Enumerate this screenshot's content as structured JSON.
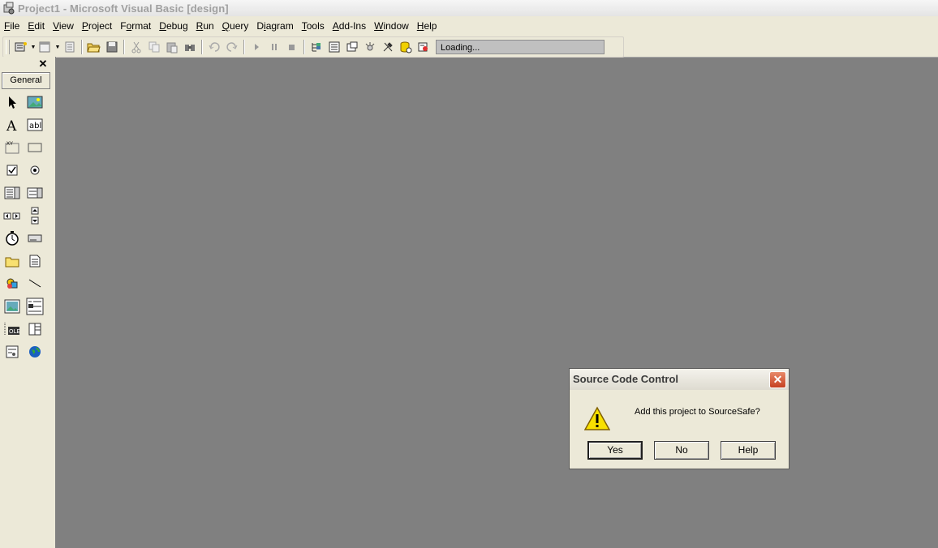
{
  "window": {
    "title": "Project1 - Microsoft Visual Basic [design]"
  },
  "menubar": {
    "items": [
      {
        "label": "File",
        "key": "F"
      },
      {
        "label": "Edit",
        "key": "E"
      },
      {
        "label": "View",
        "key": "V"
      },
      {
        "label": "Project",
        "key": "P"
      },
      {
        "label": "Format",
        "key": "o"
      },
      {
        "label": "Debug",
        "key": "D"
      },
      {
        "label": "Run",
        "key": "R"
      },
      {
        "label": "Query",
        "key": "Q"
      },
      {
        "label": "Diagram",
        "key": "i"
      },
      {
        "label": "Tools",
        "key": "T"
      },
      {
        "label": "Add-Ins",
        "key": "A"
      },
      {
        "label": "Window",
        "key": "W"
      },
      {
        "label": "Help",
        "key": "H"
      }
    ]
  },
  "toolbar": {
    "status_text": "Loading..."
  },
  "toolbox": {
    "tab_label": "General",
    "close_glyph": "✕"
  },
  "dialog": {
    "title": "Source Code Control",
    "message": "Add this project to SourceSafe?",
    "yes_label": "Yes",
    "no_label": "No",
    "help_label": "Help",
    "close_glyph": "✕"
  },
  "colors": {
    "workspace": "#808080",
    "chrome": "#ece9d8",
    "close_button": "#c64020"
  }
}
